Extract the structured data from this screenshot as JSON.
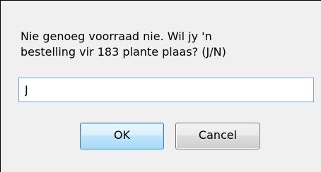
{
  "dialog": {
    "message": "Nie genoeg voorraad nie. Wil jy 'n\nbestelling vir 183 plante plaas? (J/N)",
    "input_value": "J",
    "ok_label": "OK",
    "cancel_label": "Cancel"
  }
}
